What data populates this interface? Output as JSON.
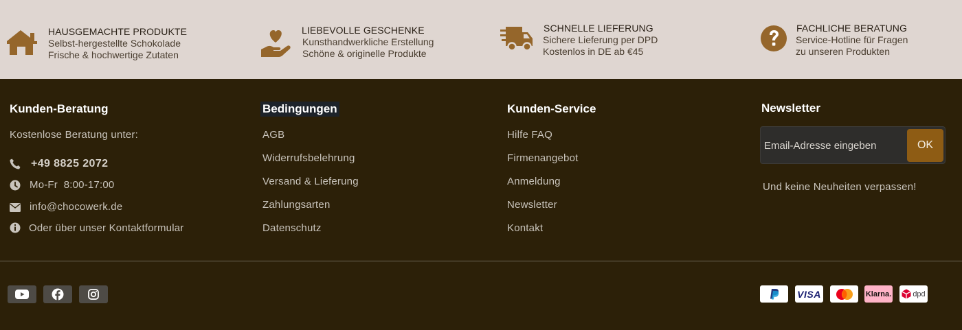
{
  "features": [
    {
      "icon": "house-icon",
      "title": "HAUSGEMACHTE PRODUKTE",
      "lines": [
        "Selbst-hergestellte Schokolade",
        "Frische & hochwertige Zutaten"
      ]
    },
    {
      "icon": "heart-hand-icon",
      "title": "LIEBEVOLLE GESCHENKE",
      "lines": [
        "Kunsthandwerkliche Erstellung",
        "Schöne & originelle Produkte"
      ]
    },
    {
      "icon": "truck-icon",
      "title": "SCHNELLE LIEFERUNG",
      "lines": [
        "Sichere Lieferung per DPD",
        "Kostenlos in DE ab €45"
      ]
    },
    {
      "icon": "question-circle-icon",
      "title": "FACHLICHE BERATUNG",
      "lines": [
        "Service-Hotline für Fragen",
        "zu unseren Produkten"
      ]
    }
  ],
  "beratung": {
    "title": "Kunden-Beratung",
    "intro": "Kostenlose Beratung unter:",
    "phone": "+49 8825 2072",
    "hours": "Mo-Fr  8:00-17:00",
    "email": "info@chocowerk.de",
    "contact": "Oder über unser Kontaktformular"
  },
  "bedingungen": {
    "title": "Bedingungen",
    "links": [
      "AGB",
      "Widerrufsbelehrung",
      "Versand & Lieferung",
      "Zahlungsarten",
      "Datenschutz"
    ]
  },
  "service": {
    "title": "Kunden-Service",
    "links": [
      "Hilfe FAQ",
      "Firmenangebot",
      "Anmeldung",
      "Newsletter",
      "Kontakt"
    ]
  },
  "newsletter": {
    "title": "Newsletter",
    "placeholder": "Email-Adresse eingeben",
    "button": "OK",
    "note": "Und keine Neuheiten verpassen!"
  },
  "social": [
    "youtube-icon",
    "facebook-icon",
    "instagram-icon"
  ],
  "payments": [
    {
      "name": "paypal-logo"
    },
    {
      "name": "visa-logo",
      "label": "VISA"
    },
    {
      "name": "mastercard-logo"
    },
    {
      "name": "klarna-logo",
      "label": "Klarna."
    },
    {
      "name": "dpd-logo",
      "label": "dpd"
    }
  ],
  "colors": {
    "accent": "#95662b",
    "footer_bg": "#2c2008",
    "strip_bg": "#dfd6d1",
    "button": "#8e5c14"
  }
}
